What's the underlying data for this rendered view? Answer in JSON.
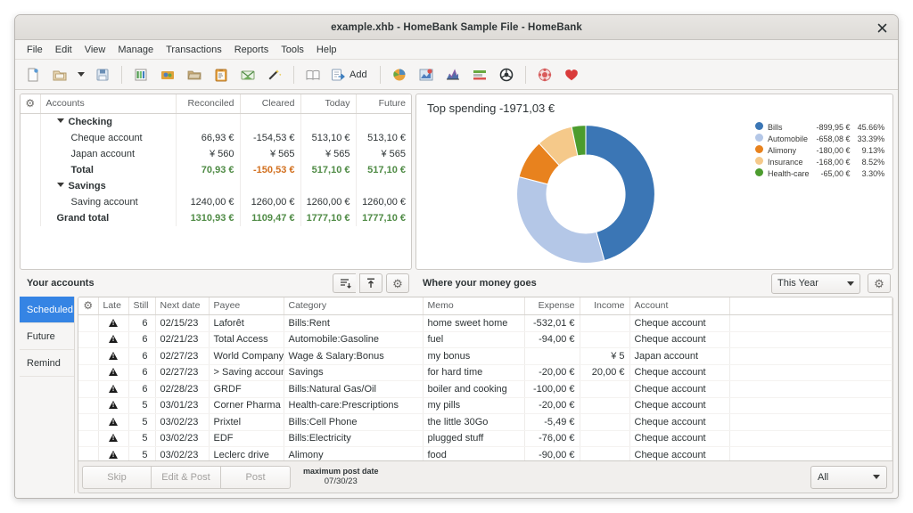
{
  "window": {
    "title": "example.xhb - HomeBank Sample File - HomeBank",
    "close_icon": "close-icon"
  },
  "menubar": {
    "items": [
      "File",
      "Edit",
      "View",
      "Manage",
      "Transactions",
      "Reports",
      "Tools",
      "Help"
    ]
  },
  "toolbar": {
    "add_label": "Add",
    "icons": [
      "new-file-icon",
      "open-folder-icon",
      "open-dropdown-arrow",
      "save-icon",
      "accounts-icon",
      "payees-icon",
      "categories-icon",
      "assignments-icon",
      "budget-icon",
      "wizard-icon",
      "ledger-icon",
      "add-transaction-icon",
      "statistics-pie-icon",
      "trend-time-icon",
      "balance-chart-icon",
      "budget-report-icon",
      "vehicle-cost-icon",
      "help-icon",
      "donate-icon"
    ]
  },
  "accounts_panel": {
    "footer_title": "Your accounts",
    "gear_icon": "gear-icon",
    "collapse_icon": "collapse-all-icon",
    "expand_icon": "expand-all-icon",
    "settings_icon": "gear-icon",
    "columns": [
      "Accounts",
      "Reconciled",
      "Cleared",
      "Today",
      "Future"
    ],
    "rows": [
      {
        "type": "group",
        "name": "Checking",
        "reconciled": "",
        "cleared": "",
        "today": "",
        "future": ""
      },
      {
        "type": "child",
        "name": "Cheque account",
        "reconciled": "66,93 €",
        "cleared": "-154,53 €",
        "today": "513,10 €",
        "future": "513,10 €",
        "r_sign": "pos",
        "c_sign": "neg",
        "t_sign": "pos",
        "f_sign": "pos"
      },
      {
        "type": "child",
        "name": "Japan account",
        "reconciled": "¥ 560",
        "cleared": "¥ 565",
        "today": "¥ 565",
        "future": "¥ 565",
        "r_sign": "pos",
        "c_sign": "pos",
        "t_sign": "pos",
        "f_sign": "pos"
      },
      {
        "type": "total",
        "name": "Total",
        "reconciled": "70,93 €",
        "cleared": "-150,53 €",
        "today": "517,10 €",
        "future": "517,10 €",
        "r_sign": "pos",
        "c_sign": "neg",
        "t_sign": "pos",
        "f_sign": "pos"
      },
      {
        "type": "group",
        "name": "Savings",
        "reconciled": "",
        "cleared": "",
        "today": "",
        "future": ""
      },
      {
        "type": "child",
        "name": "Saving account",
        "reconciled": "1240,00 €",
        "cleared": "1260,00 €",
        "today": "1260,00 €",
        "future": "1260,00 €",
        "r_sign": "pos",
        "c_sign": "pos",
        "t_sign": "pos",
        "f_sign": "pos"
      },
      {
        "type": "grand",
        "name": "Grand total",
        "reconciled": "1310,93 €",
        "cleared": "1109,47 €",
        "today": "1777,10 €",
        "future": "1777,10 €",
        "r_sign": "pos",
        "c_sign": "pos",
        "t_sign": "pos",
        "f_sign": "pos"
      }
    ]
  },
  "chart_panel": {
    "footer_title": "Where your money goes",
    "range_selected": "This Year",
    "settings_icon": "gear-icon"
  },
  "chart_data": {
    "type": "pie",
    "title": "Top spending -1971,03 €",
    "variant": "donut",
    "total": -1971.03,
    "currency": "€",
    "legend_position": "right",
    "categories": [
      "Bills",
      "Automobile",
      "Alimony",
      "Insurance",
      "Health-care"
    ],
    "values": [
      -899.95,
      -658.08,
      -180.0,
      -168.0,
      -65.0
    ],
    "percents": [
      45.66,
      33.39,
      9.13,
      8.52,
      3.3
    ],
    "amount_labels": [
      "-899,95 €",
      "-658,08 €",
      "-180,00 €",
      "-168,00 €",
      "-65,00 €"
    ],
    "percent_labels": [
      "45.66%",
      "33.39%",
      "9.13%",
      "8.52%",
      "3.30%"
    ],
    "colors": [
      "#3b76b5",
      "#b4c7e7",
      "#e8821e",
      "#f5c98a",
      "#4c9c2e"
    ]
  },
  "scheduled_panel": {
    "tabs": [
      {
        "label": "Scheduled",
        "active": true
      },
      {
        "label": "Future",
        "active": false
      },
      {
        "label": "Remind",
        "active": false
      }
    ],
    "gear_icon": "gear-icon",
    "columns": [
      "Late",
      "Still",
      "Next date",
      "Payee",
      "Category",
      "Memo",
      "Expense",
      "Income",
      "Account"
    ],
    "rows": [
      {
        "warn": "warning-icon",
        "late": "6",
        "still": "",
        "next_date": "02/15/23",
        "payee": "Laforêt",
        "category": "Bills:Rent",
        "memo": "home sweet home",
        "expense": "-532,01 €",
        "income": "",
        "account": "Cheque account"
      },
      {
        "warn": "warning-icon",
        "late": "6",
        "still": "",
        "next_date": "02/21/23",
        "payee": "Total Access",
        "category": "Automobile:Gasoline",
        "memo": "fuel",
        "expense": "-94,00 €",
        "income": "",
        "account": "Cheque account"
      },
      {
        "warn": "warning-icon",
        "late": "6",
        "still": "",
        "next_date": "02/27/23",
        "payee": "World Company",
        "category": "Wage & Salary:Bonus",
        "memo": "my bonus",
        "expense": "",
        "income": "¥ 5",
        "account": "Japan account"
      },
      {
        "warn": "warning-icon",
        "late": "6",
        "still": "",
        "next_date": "02/27/23",
        "payee": "> Saving account",
        "category": "Savings",
        "memo": "for hard time",
        "expense": "-20,00 €",
        "income": "20,00 €",
        "account": "Cheque account"
      },
      {
        "warn": "warning-icon",
        "late": "6",
        "still": "",
        "next_date": "02/28/23",
        "payee": "GRDF",
        "category": "Bills:Natural Gas/Oil",
        "memo": "boiler and cooking",
        "expense": "-100,00 €",
        "income": "",
        "account": "Cheque account"
      },
      {
        "warn": "warning-icon",
        "late": "5",
        "still": "",
        "next_date": "03/01/23",
        "payee": "Corner Pharma",
        "category": "Health-care:Prescriptions",
        "memo": "my pills",
        "expense": "-20,00 €",
        "income": "",
        "account": "Cheque account"
      },
      {
        "warn": "warning-icon",
        "late": "5",
        "still": "",
        "next_date": "03/02/23",
        "payee": "Prixtel",
        "category": "Bills:Cell Phone",
        "memo": "the little 30Go",
        "expense": "-5,49 €",
        "income": "",
        "account": "Cheque account"
      },
      {
        "warn": "warning-icon",
        "late": "5",
        "still": "",
        "next_date": "03/02/23",
        "payee": "EDF",
        "category": "Bills:Electricity",
        "memo": "plugged stuff",
        "expense": "-76,00 €",
        "income": "",
        "account": "Cheque account"
      },
      {
        "warn": "warning-icon",
        "late": "5",
        "still": "",
        "next_date": "03/02/23",
        "payee": "Leclerc drive",
        "category": "Alimony",
        "memo": "food",
        "expense": "-90,00 €",
        "income": "",
        "account": "Cheque account"
      }
    ],
    "actions": {
      "skip": "Skip",
      "edit_post": "Edit & Post",
      "post": "Post"
    },
    "max_post_date_label": "maximum post date",
    "max_post_date_value": "07/30/23",
    "filter_selected": "All"
  }
}
